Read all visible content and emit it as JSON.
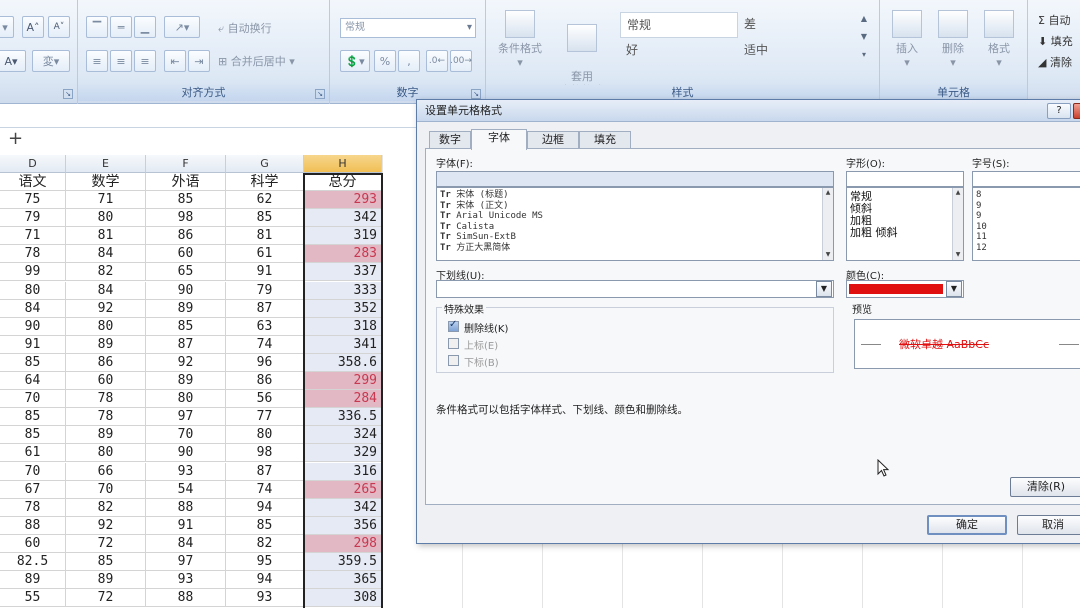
{
  "ribbon": {
    "font_btn_grow": "A",
    "font_btn_shrink": "A",
    "font_btn_font_color": "A",
    "font_btn_phonetic": "変",
    "wrap_text": "自动换行",
    "merge_center": "合并后居中",
    "number_format": "常规",
    "number_percent": "%",
    "alignment_group": "对齐方式",
    "number_group": "数字",
    "cond_format": "条件格式",
    "format_as_table": "套用\n表格格式",
    "style_normal": "常规",
    "style_bad": "差",
    "style_good": "好",
    "style_neutral": "适中",
    "styles_group": "样式",
    "insert": "插入",
    "delete": "删除",
    "format": "格式",
    "cells_group": "单元格",
    "autosum": "自动",
    "fill": "填充",
    "clear": "清除"
  },
  "sheet": {
    "add_button": "+",
    "columns": [
      "D",
      "E",
      "F",
      "G",
      "H"
    ],
    "headers": [
      "语文",
      "数学",
      "外语",
      "科学",
      "总分"
    ],
    "rows": [
      [
        "75",
        "71",
        "85",
        "62",
        "293"
      ],
      [
        "79",
        "80",
        "98",
        "85",
        "342"
      ],
      [
        "71",
        "81",
        "86",
        "81",
        "319"
      ],
      [
        "78",
        "84",
        "60",
        "61",
        "283"
      ],
      [
        "99",
        "82",
        "65",
        "91",
        "337"
      ],
      [
        "80",
        "84",
        "90",
        "79",
        "333"
      ],
      [
        "84",
        "92",
        "89",
        "87",
        "352"
      ],
      [
        "90",
        "80",
        "85",
        "63",
        "318"
      ],
      [
        "91",
        "89",
        "87",
        "74",
        "341"
      ],
      [
        "85",
        "86",
        "92",
        "96",
        "358.6"
      ],
      [
        "64",
        "60",
        "89",
        "86",
        "299"
      ],
      [
        "70",
        "78",
        "80",
        "56",
        "284"
      ],
      [
        "85",
        "78",
        "97",
        "77",
        "336.5"
      ],
      [
        "85",
        "89",
        "70",
        "80",
        "324"
      ],
      [
        "61",
        "80",
        "90",
        "98",
        "329"
      ],
      [
        "70",
        "66",
        "93",
        "87",
        "316"
      ],
      [
        "67",
        "70",
        "54",
        "74",
        "265"
      ],
      [
        "78",
        "82",
        "88",
        "94",
        "342"
      ],
      [
        "88",
        "92",
        "91",
        "85",
        "356"
      ],
      [
        "60",
        "72",
        "84",
        "82",
        "298"
      ],
      [
        "82.5",
        "85",
        "97",
        "95",
        "359.5"
      ],
      [
        "89",
        "89",
        "93",
        "94",
        "365"
      ],
      [
        "55",
        "72",
        "88",
        "93",
        "308"
      ]
    ],
    "highlight_rows": [
      0,
      3,
      10,
      11,
      16,
      19
    ]
  },
  "dialog": {
    "title": "设置单元格格式",
    "help": "?",
    "close": "✕",
    "tabs": [
      "数字",
      "字体",
      "边框",
      "填充"
    ],
    "active_tab": 1,
    "font_label": "字体(F):",
    "font_value": "",
    "font_list": [
      "宋体 (标题)",
      "宋体 (正文)",
      "Arial Unicode MS",
      "Calista",
      "SimSun-ExtB",
      "方正大黑简体"
    ],
    "style_label": "字形(O):",
    "style_value": "",
    "style_list": [
      "常规",
      "倾斜",
      "加粗",
      "加粗 倾斜"
    ],
    "size_label": "字号(S):",
    "size_value": "",
    "size_list": [
      "8",
      "9",
      "9",
      "10",
      "11",
      "12"
    ],
    "underline_label": "下划线(U):",
    "underline_value": "",
    "color_label": "颜色(C):",
    "color_value": "#e01010",
    "effects_label": "特殊效果",
    "strike_label": "删除线(K)",
    "super_label": "上标(E)",
    "sub_label": "下标(B)",
    "preview_label": "预览",
    "preview_text": "微软卓越  AaBbCc",
    "note": "条件格式可以包括字体样式、下划线、颜色和删除线。",
    "clear_button": "清除(R)",
    "ok_button": "确定",
    "cancel_button": "取消"
  },
  "colors": {
    "highlight_bg": "#e2b8c4",
    "highlight_text": "#c83850",
    "preview_text": "#e01010",
    "accent": "#3b5a86"
  },
  "icons": [
    "font-grow-icon",
    "font-shrink-icon",
    "wrap-text-icon",
    "merge-icon",
    "cond-format-icon",
    "table-format-icon",
    "insert-icon",
    "delete-icon",
    "format-icon",
    "sum-icon",
    "fill-icon",
    "eraser-icon",
    "cursor-icon"
  ]
}
